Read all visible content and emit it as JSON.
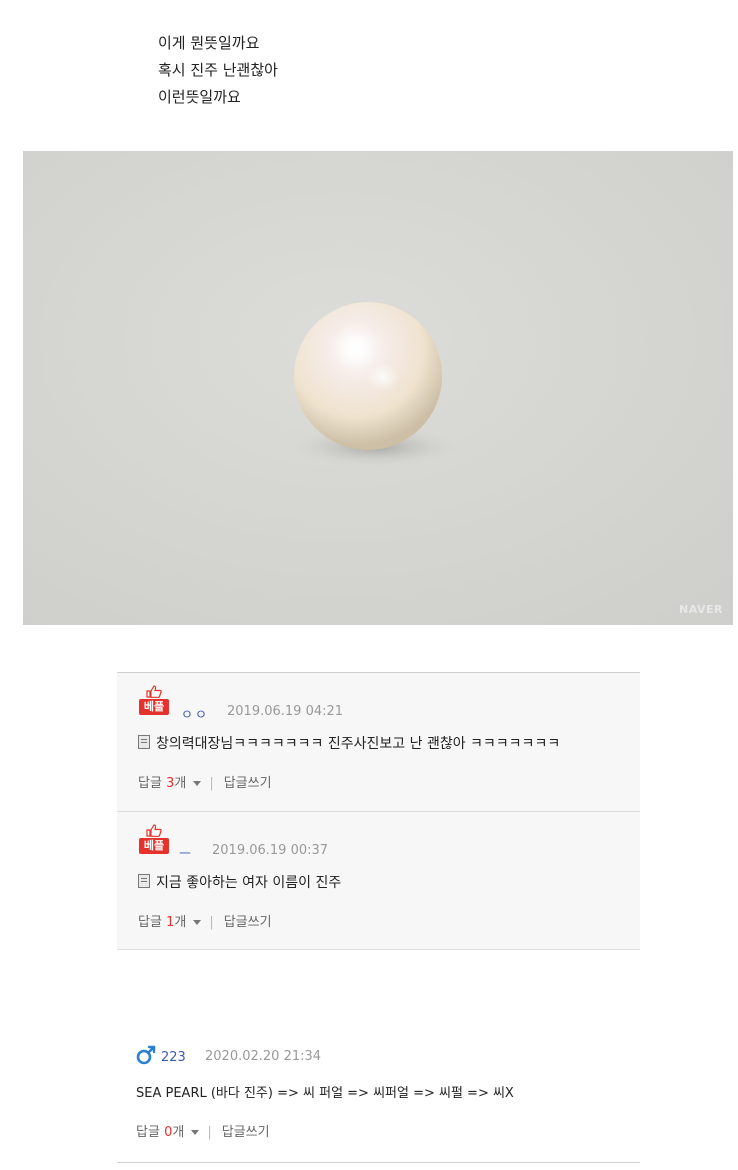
{
  "post": {
    "lines": [
      "이게 뭔뜻일까요",
      "혹시 진주 난괜찮아",
      "이런뜻일까요"
    ]
  },
  "photo": {
    "watermark": "NAVER",
    "description_icon": "pearl-photo"
  },
  "best_comments": [
    {
      "badge": "베플",
      "nick": "ㅇㅇ",
      "date": "2019.06.19 04:21",
      "text": "창의력대장님ㅋㅋㅋㅋㅋㅋㅋ 진주사진보고 난 괜찮아 ㅋㅋㅋㅋㅋㅋㅋ",
      "reply_label": "답글",
      "reply_count": "3",
      "reply_unit": "개",
      "write_reply": "답글쓰기"
    },
    {
      "badge": "베플",
      "nick": "ㅡ",
      "date": "2019.06.19 00:37",
      "text": "지금 좋아하는 여자 이름이 진주",
      "reply_label": "답글",
      "reply_count": "1",
      "reply_unit": "개",
      "write_reply": "답글쓰기"
    }
  ],
  "comment": {
    "gender_icon": "male-icon",
    "level": "223",
    "date": "2020.02.20 21:34",
    "text": "SEA PEARL (바다 진주) => 씨 퍼얼 => 씨퍼얼 => 씨펄 => 씨X",
    "reply_label": "답글",
    "reply_count": "0",
    "reply_unit": "개",
    "write_reply": "답글쓰기"
  },
  "colors": {
    "best_red": "#e6322d",
    "nick_blue": "#3a5db0",
    "date_gray": "#999999"
  }
}
